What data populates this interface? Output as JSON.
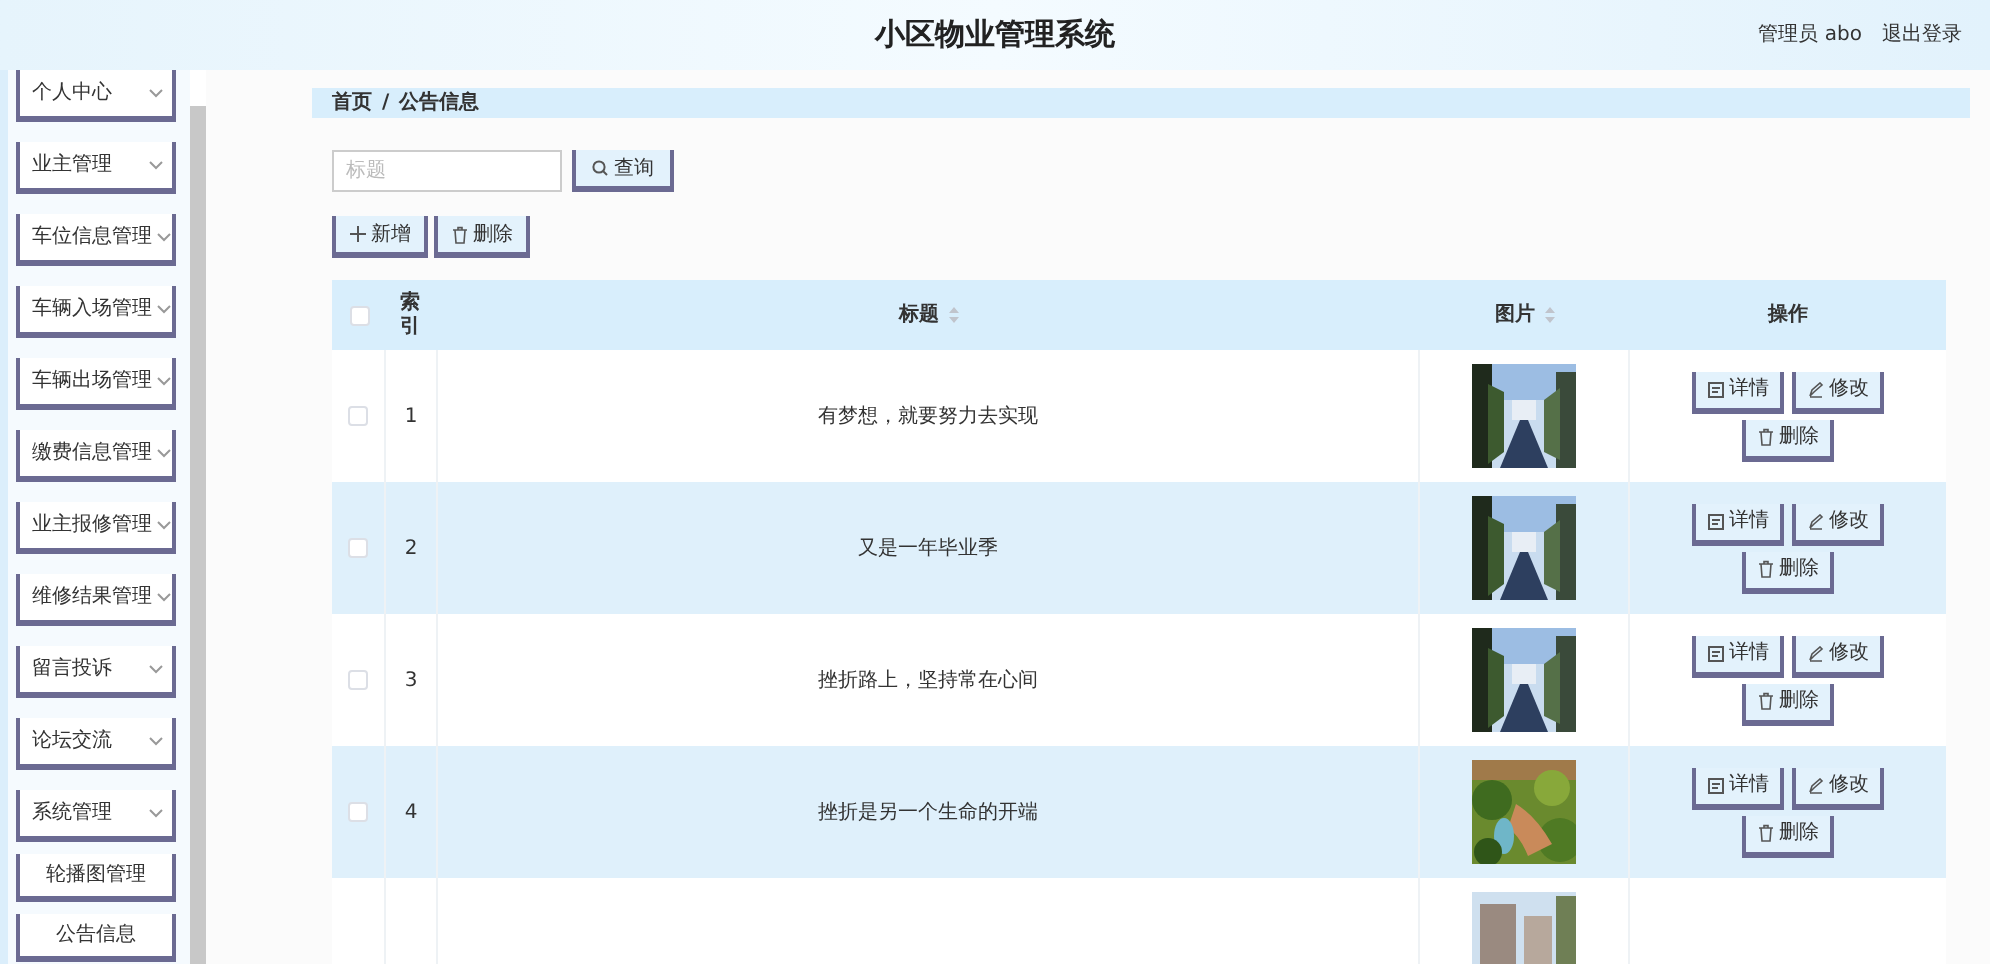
{
  "header": {
    "title": "小区物业管理系统",
    "user": "管理员 abo",
    "logout": "退出登录"
  },
  "sidebar": {
    "items": [
      {
        "label": "个人中心"
      },
      {
        "label": "业主管理"
      },
      {
        "label": "车位信息管理"
      },
      {
        "label": "车辆入场管理"
      },
      {
        "label": "车辆出场管理"
      },
      {
        "label": "缴费信息管理"
      },
      {
        "label": "业主报修管理"
      },
      {
        "label": "维修结果管理"
      },
      {
        "label": "留言投诉"
      },
      {
        "label": "论坛交流"
      },
      {
        "label": "系统管理",
        "children": [
          {
            "label": "轮播图管理"
          },
          {
            "label": "公告信息"
          }
        ]
      }
    ]
  },
  "breadcrumb": [
    "首页",
    "/",
    "公告信息"
  ],
  "search": {
    "placeholder": "标题",
    "button": "查询"
  },
  "toolbar": [
    {
      "kind": "add",
      "label": "新增"
    },
    {
      "kind": "delete",
      "label": "删除"
    }
  ],
  "table": {
    "select_all": {
      "checked": false
    },
    "columns": [
      {
        "label": "索引",
        "sortable": false
      },
      {
        "label": "标题",
        "sortable": true
      },
      {
        "label": "图片",
        "sortable": true
      },
      {
        "label": "操作",
        "sortable": false
      }
    ],
    "rows": [
      {
        "checked": false,
        "index": "1",
        "title": "有梦想，就要努力去实现",
        "image": {
          "kind": "picture"
        },
        "actions": [
          {
            "kind": "detail",
            "label": "详情"
          },
          {
            "kind": "edit",
            "label": "修改"
          },
          {
            "kind": "delete",
            "label": "删除"
          }
        ]
      },
      {
        "checked": false,
        "index": "2",
        "title": "又是一年毕业季",
        "image": {
          "kind": "picture"
        },
        "actions": [
          {
            "kind": "detail",
            "label": "详情"
          },
          {
            "kind": "edit",
            "label": "修改"
          },
          {
            "kind": "delete",
            "label": "删除"
          }
        ]
      },
      {
        "checked": false,
        "index": "3",
        "title": "挫折路上，坚持常在心间",
        "image": {
          "kind": "picture"
        },
        "actions": [
          {
            "kind": "detail",
            "label": "详情"
          },
          {
            "kind": "edit",
            "label": "修改"
          },
          {
            "kind": "delete",
            "label": "删除"
          }
        ]
      },
      {
        "checked": false,
        "index": "4",
        "title": "挫折是另一个生命的开端",
        "image": {
          "kind": "picture"
        },
        "actions": [
          {
            "kind": "detail",
            "label": "详情"
          },
          {
            "kind": "edit",
            "label": "修改"
          },
          {
            "kind": "delete",
            "label": "删除"
          }
        ]
      },
      {
        "image": {
          "kind": "picture"
        }
      }
    ]
  }
}
